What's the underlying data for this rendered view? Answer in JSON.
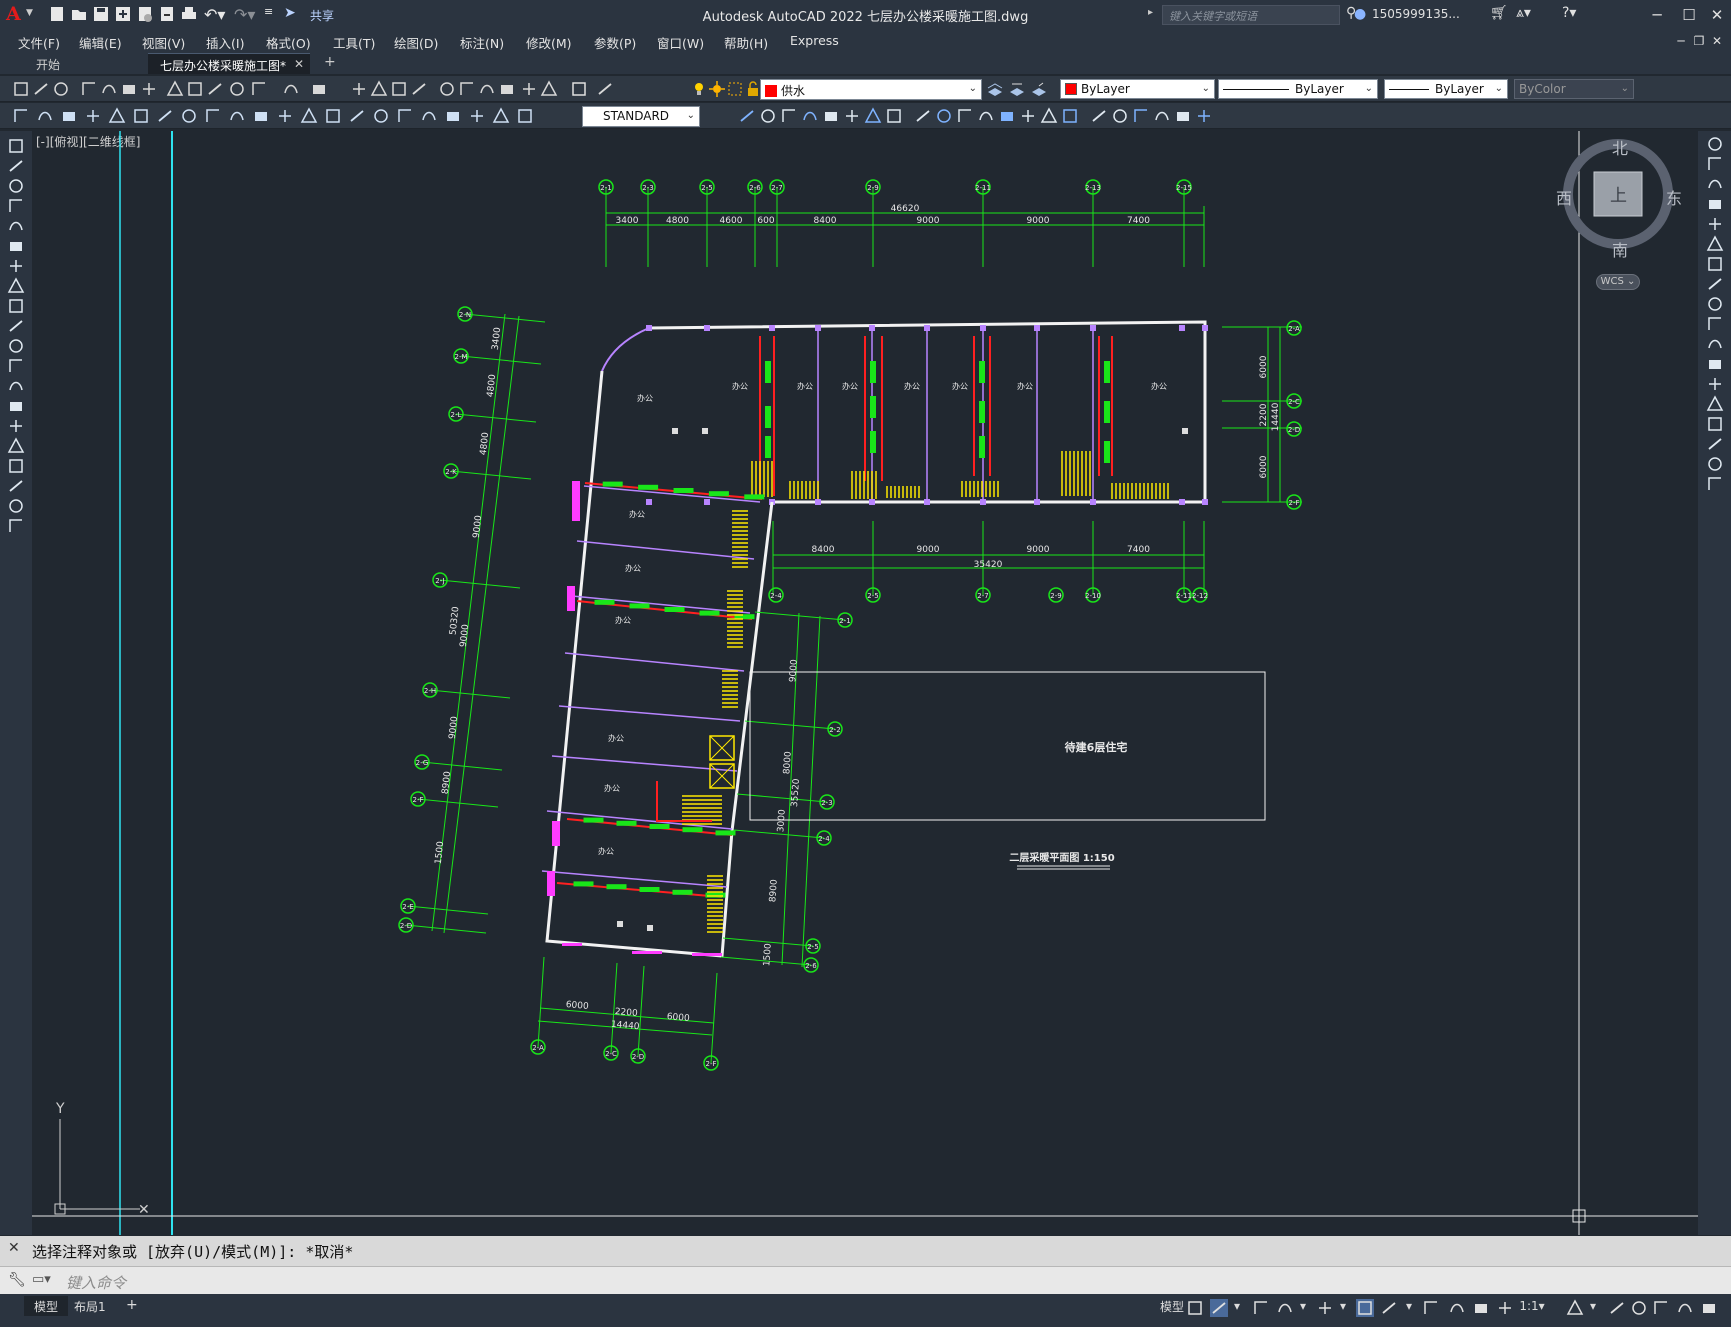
{
  "window": {
    "title": "Autodesk AutoCAD 2022    七层办公楼采暖施工图.dwg",
    "share_label": "共享",
    "search_placeholder": "键入关键字或短语",
    "user_name": "1505999135...",
    "app_logo": "A"
  },
  "menus": [
    "文件(F)",
    "编辑(E)",
    "视图(V)",
    "插入(I)",
    "格式(O)",
    "工具(T)",
    "绘图(D)",
    "标注(N)",
    "修改(M)",
    "参数(P)",
    "窗口(W)",
    "帮助(H)",
    "Express"
  ],
  "tabs": [
    {
      "label": "开始",
      "active": false
    },
    {
      "label": "七层办公楼采暖施工图*",
      "active": true
    }
  ],
  "layers": {
    "current_layer": "供水",
    "layer_color": "#ff0000",
    "color": "ByLayer",
    "linetype": "ByLayer",
    "lineweight": "ByLayer",
    "plotstyle": "ByColor"
  },
  "text_style": "STANDARD",
  "viewport_label": "[-][俯视][二维线框]",
  "viewcube": {
    "north": "北",
    "south": "南",
    "east": "东",
    "west": "西",
    "face": "上",
    "wcs": "WCS"
  },
  "drawing": {
    "top_axes": [
      "2-1",
      "2-3",
      "2-5",
      "2-6",
      "2-7",
      "2-9",
      "2-11",
      "2-13",
      "2-15"
    ],
    "top_dims": [
      "3400",
      "4800",
      "4600",
      "600",
      "8400",
      "9000",
      "9000",
      "7400"
    ],
    "top_total": "46620",
    "bottom_dims": [
      "8400",
      "9000",
      "9000",
      "7400"
    ],
    "bottom_total": "35420",
    "right_dims": [
      "6000",
      "2200",
      "6000"
    ],
    "right_total": "14440",
    "left_dims": [
      "3400",
      "4800",
      "4800",
      "9000",
      "9000",
      "9000",
      "8900",
      "1500"
    ],
    "left_total": "50320",
    "wing_bottom_dims": [
      "6000",
      "2200",
      "6000"
    ],
    "wing_bottom_total": "14440",
    "wing_right_dims": [
      "9000",
      "8000",
      "3000",
      "8900",
      "1500"
    ],
    "wing_right_total": "35520",
    "building_label": "待建6层住宅",
    "plan_title": "二层采暖平面图 1:150",
    "room_label": "办公"
  },
  "command": {
    "history": "选择注释对象或 [放弃(U)/模式(M)]: *取消*",
    "placeholder": "键入命令"
  },
  "status": {
    "model_tab": "模型",
    "layout_tab": "布局1",
    "model_btn": "模型",
    "scale": "1:1"
  }
}
